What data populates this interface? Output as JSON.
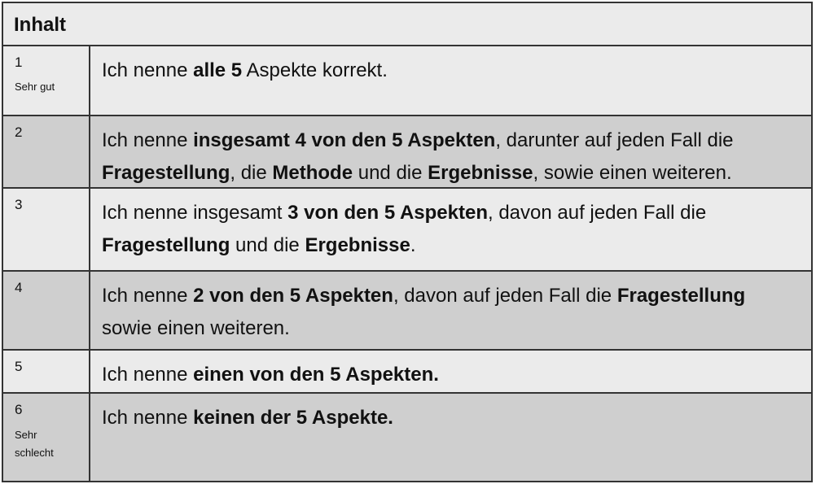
{
  "header": {
    "title": "Inhalt"
  },
  "rows": [
    {
      "grade": "1",
      "label": "Sehr gut",
      "desc": [
        {
          "t": "Ich nenne ",
          "b": false
        },
        {
          "t": "alle 5",
          "b": true
        },
        {
          "t": " Aspekte korrekt.",
          "b": false
        }
      ]
    },
    {
      "grade": "2",
      "label": "",
      "desc": [
        {
          "t": "Ich nenne ",
          "b": false
        },
        {
          "t": "insgesamt 4 von den 5 Aspekten",
          "b": true
        },
        {
          "t": ", darunter auf jeden Fall die ",
          "b": false
        },
        {
          "t": "Fragestellung",
          "b": true
        },
        {
          "t": ", die ",
          "b": false
        },
        {
          "t": "Methode",
          "b": true
        },
        {
          "t": " und die ",
          "b": false
        },
        {
          "t": "Ergebnisse",
          "b": true
        },
        {
          "t": ", sowie einen weiteren.",
          "b": false
        }
      ]
    },
    {
      "grade": "3",
      "label": "",
      "desc": [
        {
          "t": "Ich nenne insgesamt ",
          "b": false
        },
        {
          "t": "3 von den 5 Aspekten",
          "b": true
        },
        {
          "t": ", davon auf jeden Fall die ",
          "b": false
        },
        {
          "t": "Fragestellung",
          "b": true
        },
        {
          "t": " und die ",
          "b": false
        },
        {
          "t": "Ergebnisse",
          "b": true
        },
        {
          "t": ".",
          "b": false
        }
      ]
    },
    {
      "grade": "4",
      "label": "",
      "desc": [
        {
          "t": "Ich nenne ",
          "b": false
        },
        {
          "t": "2 von den 5 Aspekten",
          "b": true
        },
        {
          "t": ", davon auf jeden Fall die ",
          "b": false
        },
        {
          "t": "Fragestellung",
          "b": true
        },
        {
          "t": " sowie einen weiteren.",
          "b": false
        }
      ]
    },
    {
      "grade": "5",
      "label": "",
      "desc": [
        {
          "t": "Ich nenne ",
          "b": false
        },
        {
          "t": "einen von den 5 Aspekten.",
          "b": true
        }
      ]
    },
    {
      "grade": "6",
      "label": "Sehr schlecht",
      "desc": [
        {
          "t": "Ich nenne ",
          "b": false
        },
        {
          "t": "keinen der 5 Aspekte.",
          "b": true
        }
      ]
    }
  ]
}
